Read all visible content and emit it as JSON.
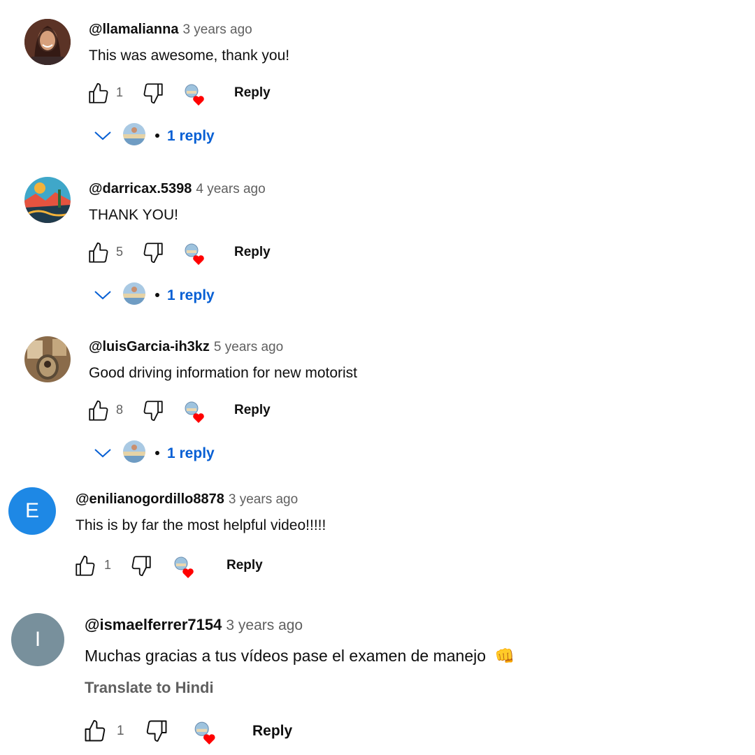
{
  "colors": {
    "link_blue": "#065fd4",
    "secondary_text": "#606060",
    "heart_red": "#ff0000",
    "avatar_e": "#1e88e5",
    "avatar_i": "#78909c"
  },
  "comments": [
    {
      "author": "@llamalianna",
      "time": "3 years ago",
      "text": "This was awesome, thank you!",
      "likes": "1",
      "reply_label": "Reply",
      "replies_label": "1 reply",
      "avatar_icon": "photo-avatar-woman"
    },
    {
      "author": "@darricax.5398",
      "time": "4 years ago",
      "text": "THANK YOU!",
      "likes": "5",
      "reply_label": "Reply",
      "replies_label": "1 reply",
      "avatar_icon": "photo-avatar-landscape"
    },
    {
      "author": "@luisGarcia-ih3kz",
      "time": "5 years ago",
      "text": "Good driving information for new motorist",
      "likes": "8",
      "reply_label": "Reply",
      "replies_label": "1 reply",
      "avatar_icon": "photo-avatar-portrait"
    },
    {
      "author": "@enilianogordillo8878",
      "time": "3 years ago",
      "text": "This is by far the most helpful video!!!!!",
      "likes": "1",
      "reply_label": "Reply",
      "avatar_letter": "E"
    },
    {
      "author": "@ismaelferrer7154",
      "time": "3 years ago",
      "text": "Muchas gracias a tus vídeos pase el examen de manejo",
      "emoji": "👊",
      "translate_label": "Translate to Hindi",
      "likes": "1",
      "reply_label": "Reply",
      "avatar_letter": "I"
    }
  ]
}
